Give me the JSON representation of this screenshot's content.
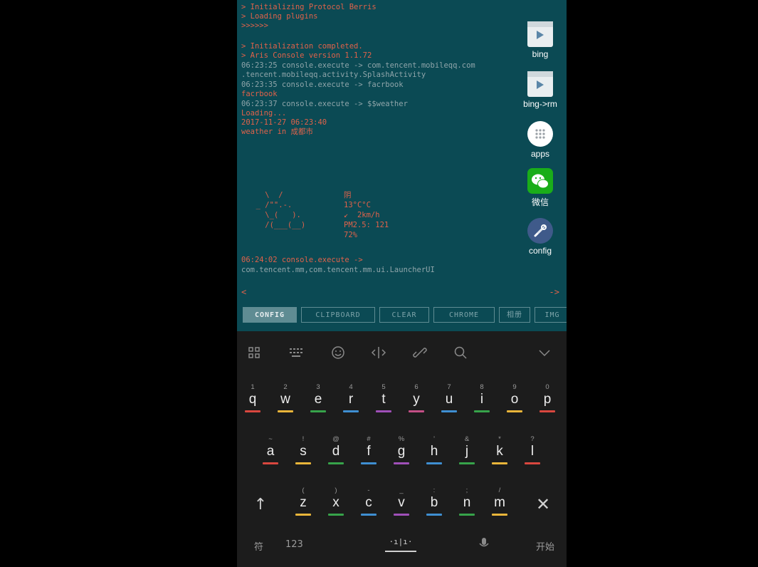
{
  "terminal": {
    "lines": [
      "> Initializing Protocol Berris",
      "> Loading plugins",
      ">>>>>>",
      "",
      "> Initialization completed.",
      "> Aris Console version 1.1.72",
      "06:23:25 console.execute -> com.tencent.mobileqq.com",
      ".tencent.mobileqq.activity.SplashActivity",
      "06:23:35 console.execute -> facrbook",
      "facrbook",
      "06:23:37 console.execute -> $$weather",
      "Loading...",
      "2017-11-27 06:23:40",
      "weather in 成都市"
    ],
    "weather_art": [
      "    \\  /",
      "  _ /\"\".-.",
      "    \\_(   ).",
      "    /(___(__)"
    ],
    "weather_info": [
      "阴",
      "13°C°C",
      "↙  2km/h",
      "PM2.5: 121",
      "72%"
    ],
    "tail_lines": [
      "06:24:02 console.execute ->",
      "com.tencent.mm,com.tencent.mm.ui.LauncherUI"
    ],
    "nav_left": "<",
    "nav_right": "->"
  },
  "sidebar": {
    "apps": [
      {
        "label": "bing",
        "icon": "bing-shortcut-icon"
      },
      {
        "label": "bing->rm",
        "icon": "bing-shortcut-icon"
      },
      {
        "label": "apps",
        "icon": "apps-grid-icon"
      },
      {
        "label": "微信",
        "icon": "wechat-icon"
      },
      {
        "label": "config",
        "icon": "config-tools-icon"
      }
    ]
  },
  "shortcuts": {
    "buttons": [
      "CONFIG",
      "CLIPBOARD",
      "CLEAR",
      "CHROME",
      "相册",
      "IMG"
    ],
    "active": "CONFIG"
  },
  "keyboard": {
    "toolbar_icons": [
      "layout-icon",
      "keyboard-icon",
      "emoji-icon",
      "cursor-move-icon",
      "link-icon",
      "search-icon",
      "collapse-chevron-icon"
    ],
    "row1": [
      {
        "main": "q",
        "alt": "1",
        "color": "#d9473f"
      },
      {
        "main": "w",
        "alt": "2",
        "color": "#e9b53a"
      },
      {
        "main": "e",
        "alt": "3",
        "color": "#37a34a"
      },
      {
        "main": "r",
        "alt": "4",
        "color": "#3f8fd2"
      },
      {
        "main": "t",
        "alt": "5",
        "color": "#9f4fb8"
      },
      {
        "main": "y",
        "alt": "6",
        "color": "#c44f86"
      },
      {
        "main": "u",
        "alt": "7",
        "color": "#3f8fd2"
      },
      {
        "main": "i",
        "alt": "8",
        "color": "#37a34a"
      },
      {
        "main": "o",
        "alt": "9",
        "color": "#e9b53a"
      },
      {
        "main": "p",
        "alt": "0",
        "color": "#d9473f"
      }
    ],
    "row2": [
      {
        "main": "a",
        "alt": "~",
        "color": "#d9473f"
      },
      {
        "main": "s",
        "alt": "!",
        "color": "#e9b53a"
      },
      {
        "main": "d",
        "alt": "@",
        "color": "#37a34a"
      },
      {
        "main": "f",
        "alt": "#",
        "color": "#3f8fd2"
      },
      {
        "main": "g",
        "alt": "%",
        "color": "#9f4fb8"
      },
      {
        "main": "h",
        "alt": "'",
        "color": "#3f8fd2"
      },
      {
        "main": "j",
        "alt": "&",
        "color": "#37a34a"
      },
      {
        "main": "k",
        "alt": "*",
        "color": "#e9b53a"
      },
      {
        "main": "l",
        "alt": "?",
        "color": "#d9473f"
      }
    ],
    "row3": [
      {
        "main": "z",
        "alt": "(",
        "color": "#e9b53a"
      },
      {
        "main": "x",
        "alt": ")",
        "color": "#37a34a"
      },
      {
        "main": "c",
        "alt": "-",
        "color": "#3f8fd2"
      },
      {
        "main": "v",
        "alt": "_",
        "color": "#9f4fb8"
      },
      {
        "main": "b",
        "alt": ":",
        "color": "#3f8fd2"
      },
      {
        "main": "n",
        "alt": ";",
        "color": "#37a34a"
      },
      {
        "main": "m",
        "alt": "/",
        "color": "#e9b53a"
      }
    ],
    "shift_symbol": "↑",
    "delete_symbol": "✕",
    "bottom": {
      "symbols": "符",
      "numbers": "123",
      "space_glyph": "·ı|ı·",
      "start": "开始"
    }
  }
}
